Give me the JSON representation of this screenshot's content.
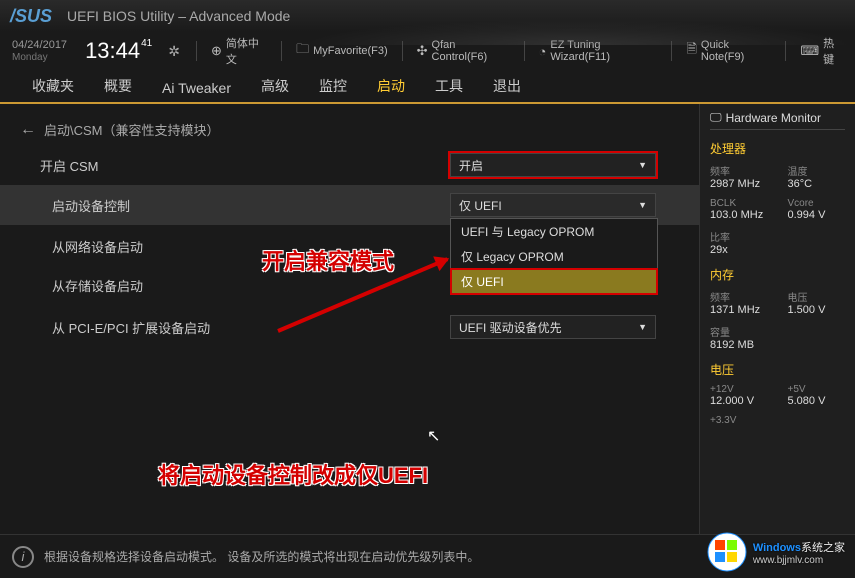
{
  "header": {
    "logo": "/SUS",
    "title": "UEFI BIOS Utility – Advanced Mode"
  },
  "infobar": {
    "date": "04/24/2017",
    "day": "Monday",
    "time": "13:44",
    "time_sec": "41",
    "language": "简体中文",
    "favorite": "MyFavorite(F3)",
    "qfan": "Qfan Control(F6)",
    "ez": "EZ Tuning Wizard(F11)",
    "quicknote": "Quick Note(F9)",
    "hotkey": "热键"
  },
  "tabs": [
    "收藏夹",
    "概要",
    "Ai Tweaker",
    "高级",
    "监控",
    "启动",
    "工具",
    "退出"
  ],
  "active_tab": "启动",
  "breadcrumb": "启动\\CSM（兼容性支持模块）",
  "settings": {
    "csm": {
      "label": "开启 CSM",
      "value": "开启"
    },
    "bootctl": {
      "label": "启动设备控制",
      "value": "仅 UEFI",
      "options": [
        "UEFI 与 Legacy OPROM",
        "仅 Legacy OPROM",
        "仅 UEFI"
      ]
    },
    "netboot": {
      "label": "从网络设备启动"
    },
    "storageboot": {
      "label": "从存储设备启动"
    },
    "pciboot": {
      "label": "从 PCI-E/PCI 扩展设备启动",
      "value": "UEFI 驱动设备优先"
    }
  },
  "annotations": {
    "a1": "开启兼容模式",
    "a2": "将启动设备控制改成仅UEFI"
  },
  "sidebar": {
    "title": "Hardware Monitor",
    "cpu_section": "处理器",
    "cpu": {
      "freq_l": "频率",
      "freq_v": "2987 MHz",
      "temp_l": "温度",
      "temp_v": "36°C",
      "bclk_l": "BCLK",
      "bclk_v": "103.0 MHz",
      "vcore_l": "Vcore",
      "vcore_v": "0.994 V",
      "ratio_l": "比率",
      "ratio_v": "29x"
    },
    "mem_section": "内存",
    "mem": {
      "freq_l": "频率",
      "freq_v": "1371 MHz",
      "volt_l": "电压",
      "volt_v": "1.500 V",
      "cap_l": "容量",
      "cap_v": "8192 MB"
    },
    "volt_section": "电压",
    "volt": {
      "v12_l": "+12V",
      "v12_v": "12.000 V",
      "v5_l": "+5V",
      "v5_v": "5.080 V",
      "v33_l": "+3.3V"
    }
  },
  "help": "根据设备规格选择设备启动模式。 设备及所选的模式将出现在启动优先级列表中。",
  "watermark": {
    "brand": "Windows",
    "site": "系统之家",
    "url": "www.bjjmlv.com"
  }
}
